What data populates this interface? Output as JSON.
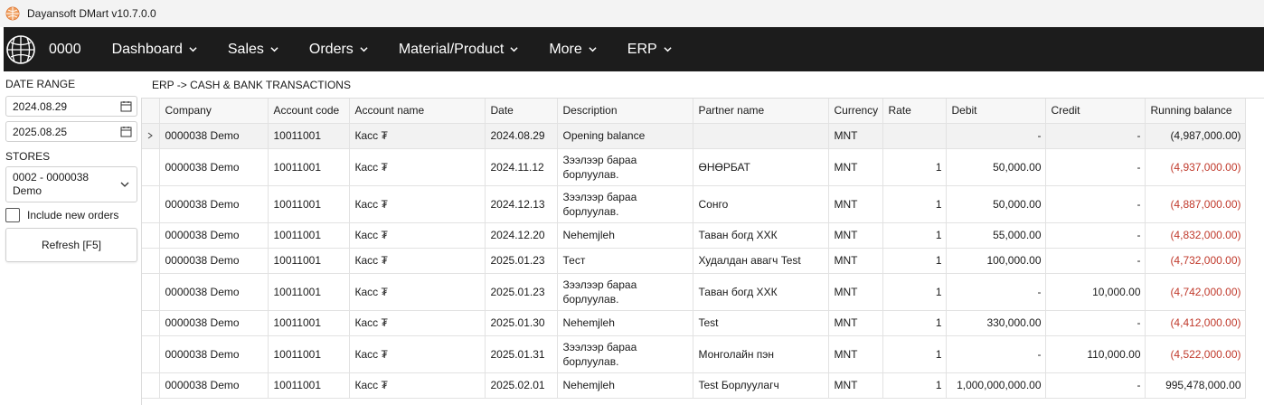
{
  "window": {
    "title": "Dayansoft DMart v10.7.0.0"
  },
  "nav": {
    "code": "0000",
    "items": [
      {
        "label": "Dashboard"
      },
      {
        "label": "Sales"
      },
      {
        "label": "Orders"
      },
      {
        "label": "Material/Product"
      },
      {
        "label": "More"
      },
      {
        "label": "ERP"
      }
    ]
  },
  "filters": {
    "date_range_label": "DATE RANGE",
    "date_from": "2024.08.29",
    "date_to": "2025.08.25",
    "stores_label": "STORES",
    "store_line1": "0002 - 0000038",
    "store_line2": "Demo",
    "include_new_orders": "Include new orders",
    "refresh_label": "Refresh [F5]"
  },
  "breadcrumb": "ERP -> CASH & BANK TRANSACTIONS",
  "colors": {
    "negative": "#c0392b",
    "navbar": "#1c1c1c"
  },
  "table": {
    "headers": [
      "Company",
      "Account code",
      "Account name",
      "Date",
      "Description",
      "Partner name",
      "Currency",
      "Rate",
      "Debit",
      "Credit",
      "Running balance"
    ],
    "rows": [
      {
        "company": "0000038 Demo",
        "code": "10011001",
        "account": "Касс ₮",
        "date": "2024.08.29",
        "desc": "Opening balance",
        "partner": "",
        "currency": "MNT",
        "rate": "",
        "debit": "-",
        "credit": "-",
        "balance": "(4,987,000.00)",
        "neg": false
      },
      {
        "company": "0000038 Demo",
        "code": "10011001",
        "account": "Касс ₮",
        "date": "2024.11.12",
        "desc": "Зээлээр бараа борлуулав.",
        "partner": "ӨНӨРБАТ",
        "currency": "MNT",
        "rate": "1",
        "debit": "50,000.00",
        "credit": "-",
        "balance": "(4,937,000.00)",
        "neg": true
      },
      {
        "company": "0000038 Demo",
        "code": "10011001",
        "account": "Касс ₮",
        "date": "2024.12.13",
        "desc": "Зээлээр бараа борлуулав.",
        "partner": "Сонго",
        "currency": "MNT",
        "rate": "1",
        "debit": "50,000.00",
        "credit": "-",
        "balance": "(4,887,000.00)",
        "neg": true
      },
      {
        "company": "0000038 Demo",
        "code": "10011001",
        "account": "Касс ₮",
        "date": "2024.12.20",
        "desc": "Nehemjleh",
        "partner": "Таван богд ХХК",
        "currency": "MNT",
        "rate": "1",
        "debit": "55,000.00",
        "credit": "-",
        "balance": "(4,832,000.00)",
        "neg": true
      },
      {
        "company": "0000038 Demo",
        "code": "10011001",
        "account": "Касс ₮",
        "date": "2025.01.23",
        "desc": "Тест",
        "partner": "Худалдан авагч Test",
        "currency": "MNT",
        "rate": "1",
        "debit": "100,000.00",
        "credit": "-",
        "balance": "(4,732,000.00)",
        "neg": true
      },
      {
        "company": "0000038 Demo",
        "code": "10011001",
        "account": "Касс ₮",
        "date": "2025.01.23",
        "desc": "Зээлээр бараа борлуулав.",
        "partner": "Таван богд ХХК",
        "currency": "MNT",
        "rate": "1",
        "debit": "-",
        "credit": "10,000.00",
        "balance": "(4,742,000.00)",
        "neg": true
      },
      {
        "company": "0000038 Demo",
        "code": "10011001",
        "account": "Касс ₮",
        "date": "2025.01.30",
        "desc": "Nehemjleh",
        "partner": "Test",
        "currency": "MNT",
        "rate": "1",
        "debit": "330,000.00",
        "credit": "-",
        "balance": "(4,412,000.00)",
        "neg": true
      },
      {
        "company": "0000038 Demo",
        "code": "10011001",
        "account": "Касс ₮",
        "date": "2025.01.31",
        "desc": "Зээлээр бараа борлуулав.",
        "partner": "Монголайн пэн",
        "currency": "MNT",
        "rate": "1",
        "debit": "-",
        "credit": "110,000.00",
        "balance": "(4,522,000.00)",
        "neg": true
      },
      {
        "company": "0000038 Demo",
        "code": "10011001",
        "account": "Касс ₮",
        "date": "2025.02.01",
        "desc": "Nehemjleh",
        "partner": "Test Борлуулагч",
        "currency": "MNT",
        "rate": "1",
        "debit": "1,000,000,000.00",
        "credit": "-",
        "balance": "995,478,000.00",
        "neg": false
      }
    ]
  }
}
